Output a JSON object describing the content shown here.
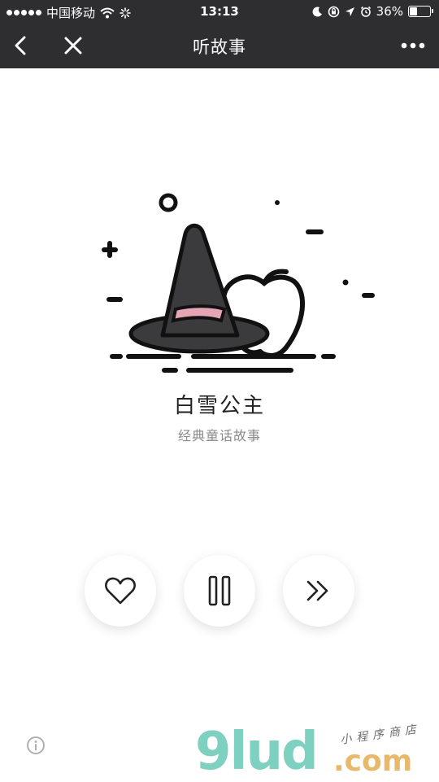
{
  "status_bar": {
    "carrier": "中国移动",
    "time": "13:13",
    "battery": "36%",
    "battery_level": 0.36
  },
  "nav": {
    "title": "听故事",
    "back_icon": "chevron-left-icon",
    "close_icon": "close-icon",
    "more_icon": "more-horizontal-icon"
  },
  "story": {
    "title": "白雪公主",
    "subtitle": "经典童话故事"
  },
  "controls": {
    "like_icon": "heart-icon",
    "pause_icon": "pause-icon",
    "next_icon": "fast-forward-icon"
  },
  "info_icon": "info-icon",
  "watermark": {
    "logo": "9lud",
    "domain": ".com",
    "tagline": "小程序商店"
  },
  "colors": {
    "bar_background": "#2e2e31",
    "hat": "#3b3a3d",
    "hat_band": "#e6a5b5",
    "outline": "#111111"
  }
}
